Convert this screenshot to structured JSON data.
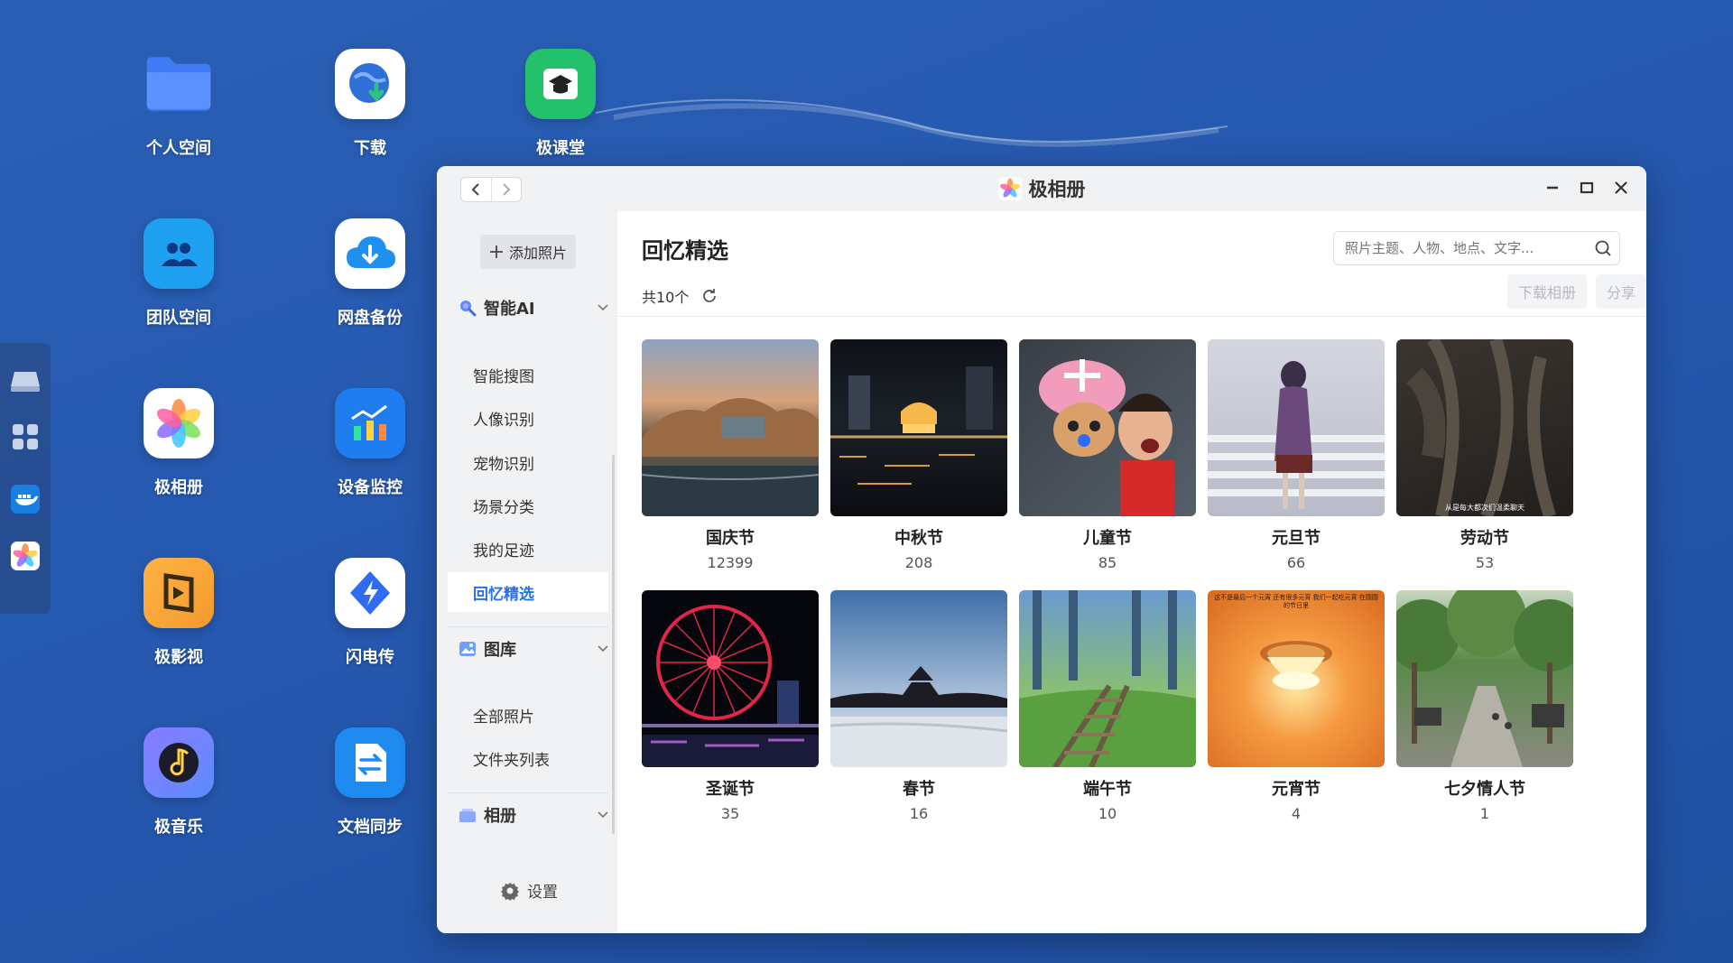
{
  "desktop": {
    "icons": [
      {
        "label": "个人空间",
        "icon": "folder-icon"
      },
      {
        "label": "下载",
        "icon": "download-globe-icon"
      },
      {
        "label": "极课堂",
        "icon": "graduation-cap-icon"
      },
      {
        "label": "团队空间",
        "icon": "team-folder-icon"
      },
      {
        "label": "网盘备份",
        "icon": "cloud-download-icon"
      },
      {
        "label": "极相册",
        "icon": "photos-flower-icon"
      },
      {
        "label": "设备监控",
        "icon": "chart-monitor-icon"
      },
      {
        "label": "极影视",
        "icon": "video-clapper-icon"
      },
      {
        "label": "闪电传",
        "icon": "lightning-icon"
      },
      {
        "label": "极音乐",
        "icon": "music-note-icon"
      },
      {
        "label": "文档同步",
        "icon": "sync-arrows-icon"
      }
    ]
  },
  "dock": {
    "items": [
      "drive-icon",
      "apps-grid-icon",
      "docker-icon",
      "photos-flower-icon"
    ]
  },
  "window": {
    "title": "极相册",
    "controls": [
      "minimize-icon",
      "maximize-icon",
      "close-icon"
    ]
  },
  "sidebar": {
    "add_photos": "添加照片",
    "sections": [
      {
        "title": "智能AI",
        "icon": "search-ai-icon",
        "items": [
          "智能搜图",
          "人像识别",
          "宠物识别",
          "场景分类",
          "我的足迹",
          "回忆精选"
        ]
      },
      {
        "title": "图库",
        "icon": "gallery-icon",
        "items": [
          "全部照片",
          "文件夹列表"
        ]
      },
      {
        "title": "相册",
        "icon": "album-icon",
        "items": []
      }
    ],
    "active_item": "回忆精选",
    "settings": "设置"
  },
  "main": {
    "title": "回忆精选",
    "search_placeholder": "照片主题、人物、地点、文字...",
    "count_text": "共10个",
    "download_album": "下载相册",
    "share": "分享",
    "memories": [
      {
        "name": "国庆节",
        "count": "12399"
      },
      {
        "name": "中秋节",
        "count": "208"
      },
      {
        "name": "儿童节",
        "count": "85"
      },
      {
        "name": "元旦节",
        "count": "66"
      },
      {
        "name": "劳动节",
        "count": "53"
      },
      {
        "name": "圣诞节",
        "count": "35"
      },
      {
        "name": "春节",
        "count": "16"
      },
      {
        "name": "端午节",
        "count": "10"
      },
      {
        "name": "元宵节",
        "count": "4"
      },
      {
        "name": "七夕情人节",
        "count": "1"
      }
    ],
    "thumb_captions": {
      "labor_day": "从是每大都次们温柔聊天",
      "lantern": "这不是最后一个元宵 还有很多元宵 我们一起吃元宵 在圆圆的节日里"
    }
  }
}
